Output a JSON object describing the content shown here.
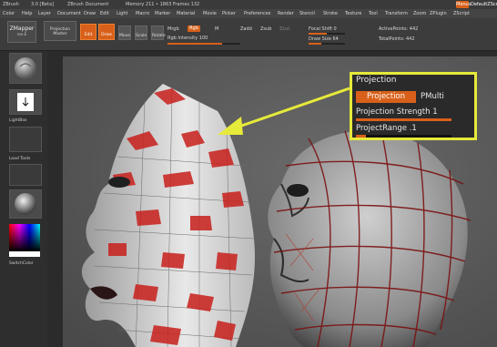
{
  "title_bar": {
    "app": "ZBrush",
    "version": "3.0 [Beta]",
    "doc": "ZBrush Document",
    "mem": "Memory 211 • 1863  Frames 132",
    "right_btn": "Menus",
    "right_btn2": "DefaultZScript"
  },
  "menu_bar": [
    "Color",
    "Help",
    "Layer",
    "Document",
    "Draw",
    "Edit",
    "Light",
    "Macro",
    "Marker",
    "Material",
    "Movie",
    "Picker",
    "Preferences",
    "Render",
    "Stencil",
    "Stroke",
    "Texture",
    "Tool",
    "Transform",
    "Zoom",
    "ZPlugin",
    "ZScript"
  ],
  "toolbar": {
    "zmapper_label": "ZMapper",
    "zmapper_sub": "rev-E",
    "projection_master": "Projection Master",
    "edit_btn": "Edit",
    "draw_btn": "Draw",
    "move_btn": "Move",
    "scale_btn": "Scale",
    "rotate_btn": "Rotate",
    "mrgb": "Mrgb",
    "rgb": "Rgb",
    "m": "M",
    "rgb_intensity": "Rgb Intensity 100",
    "zadd": "Zadd",
    "zsub": "Zsub",
    "zcut": "Zcut",
    "focal_shift": "Focal Shift 0",
    "draw_size": "Draw Size 64",
    "active_points": "ActivePoints: 442",
    "total_points": "TotalPoints: 442"
  },
  "left_panel": {
    "lightbox_label": "LightBox",
    "load_tools_label": "Load Tools",
    "switchcolor_label": "SwitchColor"
  },
  "projection_panel": {
    "title": "Projection",
    "projection_btn": "Projection",
    "pmulti": "PMulti",
    "strength_label": "Projection Strength",
    "strength_value": "1",
    "strength_level": 1.0,
    "range_label": "ProjectRange",
    "range_value": ".1",
    "range_level": 0.1
  },
  "colors": {
    "accent": "#d8601a",
    "highlight": "#e6ea3a",
    "paint": "#c8201c"
  }
}
